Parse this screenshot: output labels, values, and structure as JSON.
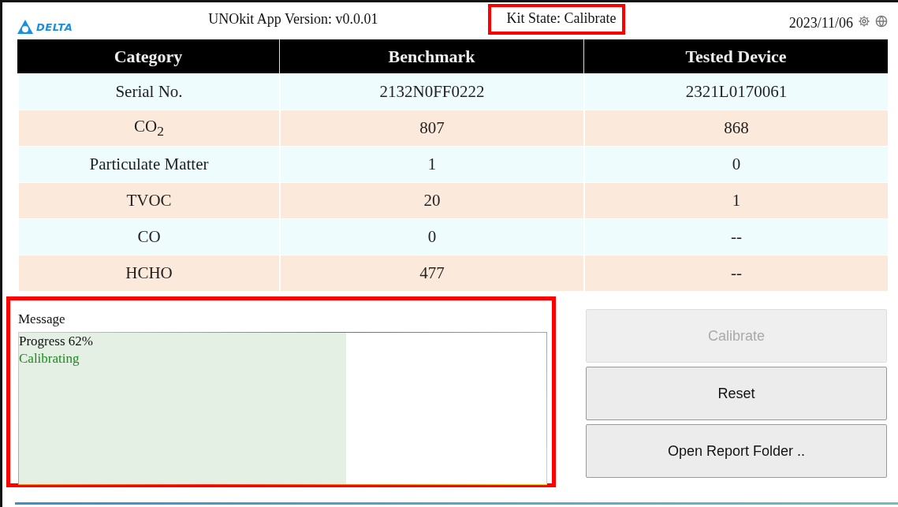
{
  "header": {
    "logo": "DELTA",
    "app_version": "UNOkit App Version: v0.0.01",
    "kit_state": {
      "text": "Kit State: Calibrate",
      "highlighted": true
    },
    "date": "2023/11/06"
  },
  "table": {
    "columns": [
      "Category",
      "Benchmark",
      "Tested Device"
    ],
    "rows": [
      [
        "Serial No.",
        "2132N0FF0222",
        "2321L0170061"
      ],
      [
        "CO$_{2}$",
        "807",
        "868"
      ],
      [
        "Particulate Matter",
        "1",
        "0"
      ],
      [
        "TVOC",
        "20",
        "1"
      ],
      [
        "CO",
        "0",
        "--"
      ],
      [
        "HCHO",
        "477",
        "--"
      ]
    ]
  },
  "message": {
    "label": "Message",
    "highlighted": true,
    "level": 0.62,
    "lines": [
      {
        "text": "Progress 62%",
        "kind": "info"
      },
      {
        "text": "Calibrating",
        "kind": "status"
      }
    ]
  },
  "buttons": [
    {
      "label": "Calibrate",
      "disabled": true
    },
    {
      "label": "Reset",
      "disabled": false
    },
    {
      "label": "Open Report Folder ..",
      "disabled": false
    }
  ]
}
